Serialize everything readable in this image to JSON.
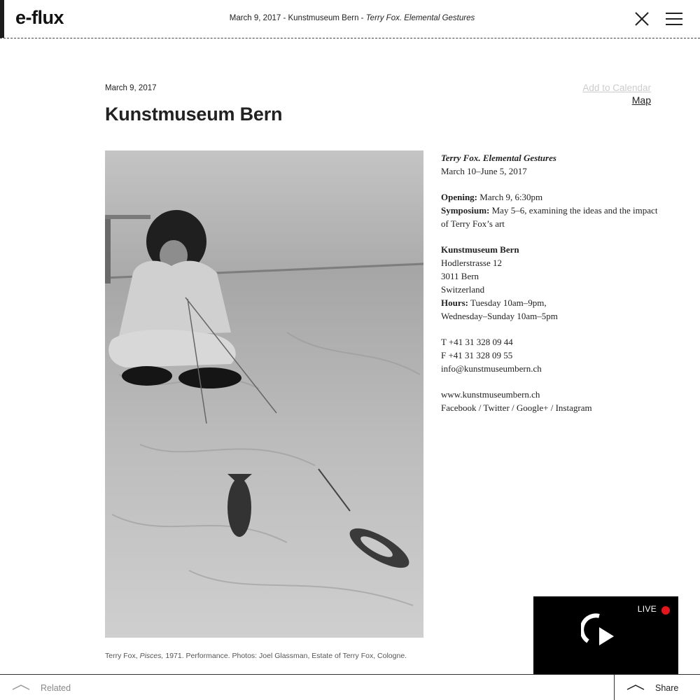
{
  "header": {
    "logo": "e-flux",
    "title_prefix": "March 9, 2017 - Kunstmuseum Bern - ",
    "title_italic": "Terry Fox. Elemental Gestures"
  },
  "article": {
    "date": "March 9, 2017",
    "title": "Kunstmuseum Bern",
    "add_to_calendar": "Add to Calendar",
    "map": "Map",
    "caption_prefix": "Terry Fox, ",
    "caption_italic": "Pisces,",
    "caption_suffix": " 1971. Performance. Photos: Joel Glassman, Estate of Terry Fox, Cologne."
  },
  "info": {
    "exhibition_title": "Terry Fox. Elemental Gestures",
    "exhibition_dates": "March 10–June 5, 2017",
    "opening_label": "Opening:",
    "opening_value": " March 9, 6:30pm",
    "symposium_label": "Symposium:",
    "symposium_value_1": " May 5–6, examining the ideas and the impact",
    "symposium_value_2": "of Terry Fox’s art",
    "venue_name": "Kunstmuseum Bern",
    "street": "Hodlerstrasse 12",
    "city": "3011 Bern",
    "country": "Switzerland",
    "hours_label": "Hours:",
    "hours_value_1": " Tuesday 10am–9pm,",
    "hours_value_2": "Wednesday–Sunday 10am–5pm",
    "phone": "T +41 31 328 09 44",
    "fax": "F +41 31 328 09 55",
    "email": "info@kunstmuseumbern.ch",
    "website": "www.kunstmuseumbern.ch",
    "social": "Facebook / Twitter / Google+ / Instagram"
  },
  "live": {
    "label": "LIVE",
    "dot_color": "#e8141b"
  },
  "footer": {
    "related": "Related",
    "share": "Share"
  },
  "icons": {
    "close": "close-icon",
    "menu": "menu-icon",
    "play": "play-icon",
    "arrow": "chevron-up-icon"
  }
}
